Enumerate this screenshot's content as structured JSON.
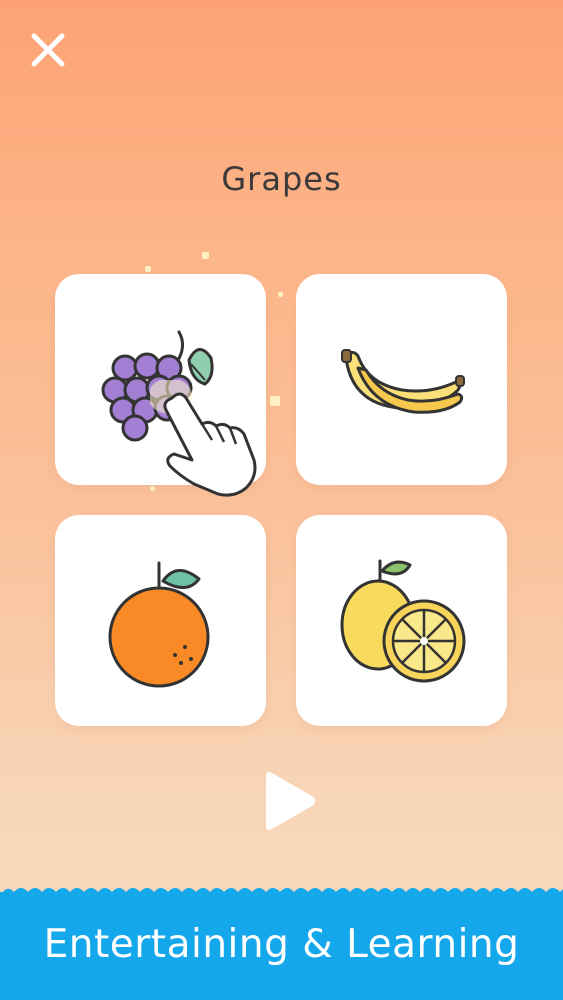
{
  "header": {
    "close_icon": "close-icon"
  },
  "quiz": {
    "title": "Grapes",
    "options": [
      {
        "name": "grapes",
        "icon": "grapes-icon"
      },
      {
        "name": "banana",
        "icon": "banana-icon"
      },
      {
        "name": "orange",
        "icon": "orange-icon"
      },
      {
        "name": "lemon",
        "icon": "lemon-icon"
      }
    ],
    "hint": {
      "icon": "pointing-hand-icon",
      "target": "grapes"
    }
  },
  "controls": {
    "play_icon": "play-icon"
  },
  "banner": {
    "text": "Entertaining & Learning",
    "color": "#15a7ec"
  },
  "colors": {
    "background_top": "#fca276",
    "background_bottom": "#f6dcc0",
    "title_text": "#3a3a3a",
    "card": "#ffffff"
  }
}
